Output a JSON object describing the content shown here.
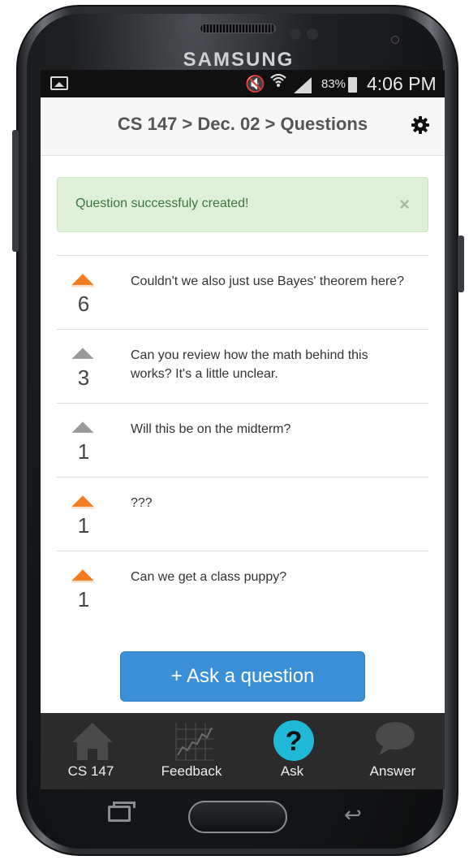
{
  "device": {
    "brand": "SAMSUNG"
  },
  "status_bar": {
    "battery_percent": "83%",
    "time": "4:06 PM"
  },
  "header": {
    "breadcrumb": "CS 147 > Dec. 02 > Questions"
  },
  "alert": {
    "message": "Question successfuly created!",
    "close_label": "×"
  },
  "questions": [
    {
      "votes": "6",
      "text": "Couldn't we also just use Bayes' theorem here?",
      "upvoted": true
    },
    {
      "votes": "3",
      "text": "Can you review how the math behind this works? It's a little unclear.",
      "upvoted": false
    },
    {
      "votes": "1",
      "text": "Will this be on the midterm?",
      "upvoted": false
    },
    {
      "votes": "1",
      "text": "???",
      "upvoted": true
    },
    {
      "votes": "1",
      "text": "Can we get a class puppy?",
      "upvoted": true
    }
  ],
  "ask_button": {
    "label": "+ Ask a question"
  },
  "tabs": [
    {
      "label": "CS 147",
      "icon": "home-icon",
      "active": false
    },
    {
      "label": "Feedback",
      "icon": "chart-icon",
      "active": false
    },
    {
      "label": "Ask",
      "icon": "question-icon",
      "active": true
    },
    {
      "label": "Answer",
      "icon": "speech-bubble-icon",
      "active": false
    }
  ],
  "colors": {
    "upvote_active": "#f47c20",
    "upvote_inactive": "#9a9a9a",
    "ask_accent": "#1fb8d6",
    "primary_button": "#3a8fd6",
    "alert_bg": "#dff0d8",
    "alert_text": "#3c763d"
  }
}
